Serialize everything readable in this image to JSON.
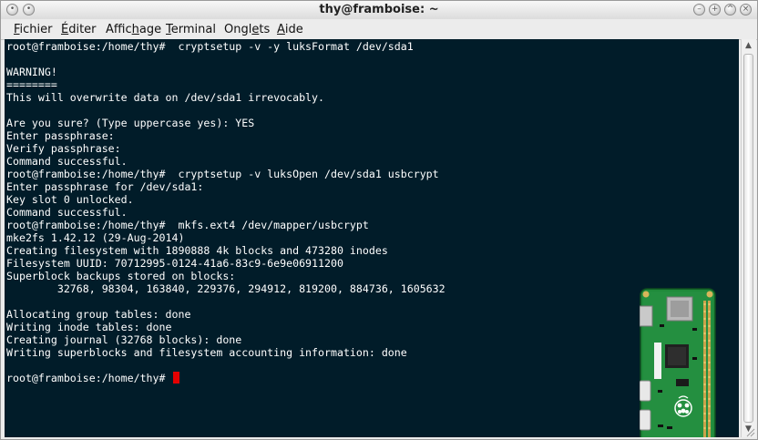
{
  "window": {
    "title": "thy@framboise: ~"
  },
  "menu": [
    {
      "label_pre": "",
      "mnemonic": "F",
      "label_post": "ichier"
    },
    {
      "label_pre": "",
      "mnemonic": "É",
      "label_post": "diter"
    },
    {
      "label_pre": "Affic",
      "mnemonic": "h",
      "label_post": "age"
    },
    {
      "label_pre": "",
      "mnemonic": "T",
      "label_post": "erminal"
    },
    {
      "label_pre": "Ongl",
      "mnemonic": "e",
      "label_post": "ts"
    },
    {
      "label_pre": "",
      "mnemonic": "A",
      "label_post": "ide"
    }
  ],
  "terminal": {
    "lines": [
      "root@framboise:/home/thy#  cryptsetup -v -y luksFormat /dev/sda1",
      "",
      "WARNING!",
      "========",
      "This will overwrite data on /dev/sda1 irrevocably.",
      "",
      "Are you sure? (Type uppercase yes): YES",
      "Enter passphrase:",
      "Verify passphrase:",
      "Command successful.",
      "root@framboise:/home/thy#  cryptsetup -v luksOpen /dev/sda1 usbcrypt",
      "Enter passphrase for /dev/sda1:",
      "Key slot 0 unlocked.",
      "Command successful.",
      "root@framboise:/home/thy#  mkfs.ext4 /dev/mapper/usbcrypt",
      "mke2fs 1.42.12 (29-Aug-2014)",
      "Creating filesystem with 1890888 4k blocks and 473280 inodes",
      "Filesystem UUID: 70712995-0124-41a6-83c9-6e9e06911200",
      "Superblock backups stored on blocks:",
      "        32768, 98304, 163840, 229376, 294912, 819200, 884736, 1605632",
      "",
      "Allocating group tables: done",
      "Writing inode tables: done",
      "Creating journal (32768 blocks): done",
      "Writing superblocks and filesystem accounting information: done",
      "",
      "root@framboise:/home/thy# "
    ]
  },
  "overlay": {
    "image": "raspberry-pi-zero-board"
  },
  "colors": {
    "terminal_bg": "#011c29",
    "terminal_fg": "#ffffff",
    "cursor": "#e50000"
  }
}
